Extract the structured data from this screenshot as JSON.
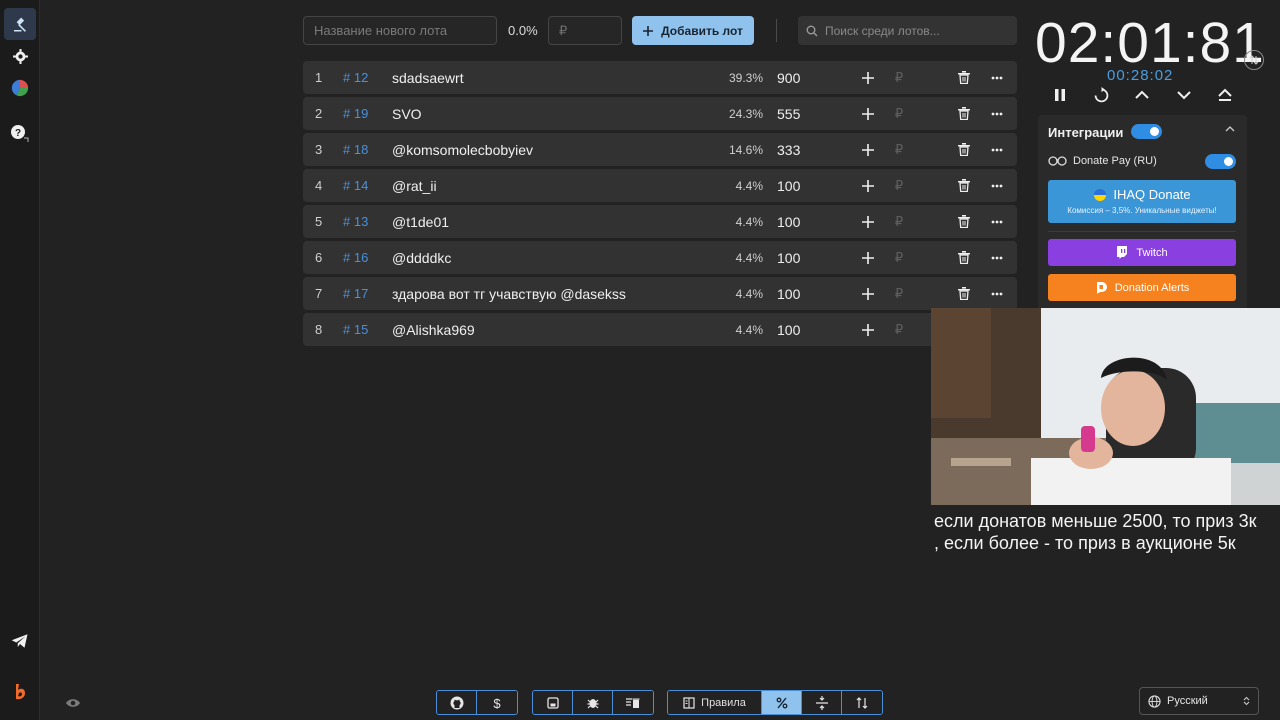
{
  "sidebar": {
    "items": [
      {
        "name": "gavel-icon"
      },
      {
        "name": "gear-icon"
      },
      {
        "name": "pie-chart-icon"
      },
      {
        "name": "help-icon"
      }
    ],
    "bottom": [
      {
        "name": "telegram-icon"
      },
      {
        "name": "brand-logo"
      }
    ]
  },
  "top": {
    "lot_name_placeholder": "Название нового лота",
    "percent": "0.0%",
    "amount_placeholder": "₽",
    "add_button": "Добавить лот",
    "search_placeholder": "Поиск среди лотов..."
  },
  "lots": [
    {
      "idx": "1",
      "id": "# 12",
      "name": "sdadsaewrt",
      "pct": "39.3%",
      "amount": "900",
      "currency": "₽",
      "deletable": true
    },
    {
      "idx": "2",
      "id": "# 19",
      "name": "SVO",
      "pct": "24.3%",
      "amount": "555",
      "currency": "₽",
      "deletable": true
    },
    {
      "idx": "3",
      "id": "# 18",
      "name": "@komsomolecbobyiev",
      "pct": "14.6%",
      "amount": "333",
      "currency": "₽",
      "deletable": true
    },
    {
      "idx": "4",
      "id": "# 14",
      "name": "@rat_ii",
      "pct": "4.4%",
      "amount": "100",
      "currency": "₽",
      "deletable": true
    },
    {
      "idx": "5",
      "id": "# 13",
      "name": "@t1de01",
      "pct": "4.4%",
      "amount": "100",
      "currency": "₽",
      "deletable": true
    },
    {
      "idx": "6",
      "id": "# 16",
      "name": "@ddddkc",
      "pct": "4.4%",
      "amount": "100",
      "currency": "₽",
      "deletable": true
    },
    {
      "idx": "7",
      "id": "# 17",
      "name": "здарова вот тг учавствую @dasekss",
      "pct": "4.4%",
      "amount": "100",
      "currency": "₽",
      "deletable": true
    },
    {
      "idx": "8",
      "id": "# 15",
      "name": "@Alishka969",
      "pct": "4.4%",
      "amount": "100",
      "currency": "₽",
      "deletable": false
    }
  ],
  "timer": {
    "main": "02:01:81",
    "sub": "00:28:02",
    "controls": [
      "pause-icon",
      "reset-icon",
      "chevron-up-icon",
      "chevron-down-icon",
      "collapse-icon"
    ]
  },
  "integrations": {
    "title": "Интеграции",
    "enabled": true,
    "donate_pay": {
      "label": "Donate Pay (RU)",
      "enabled": true
    },
    "ihaq": {
      "title": "IHAQ Donate",
      "subtitle": "Комиссия – 3,5%. Уникальные виджеты!"
    },
    "twitch": "Twitch",
    "donation_alerts": "Donation Alerts"
  },
  "overlay": {
    "caption_line1": "если донатов меньше 2500, то приз 3к",
    "caption_line2": ", если более - то приз в аукционе 5к"
  },
  "bottom_toolbar": {
    "rules_label": "Правила",
    "language": "Русский"
  },
  "colors": {
    "accent": "#8fc3ee",
    "link": "#4a90d9",
    "twitch": "#8a3fe0",
    "donation_alerts": "#f5821f",
    "ihaq": "#3a96d6"
  }
}
